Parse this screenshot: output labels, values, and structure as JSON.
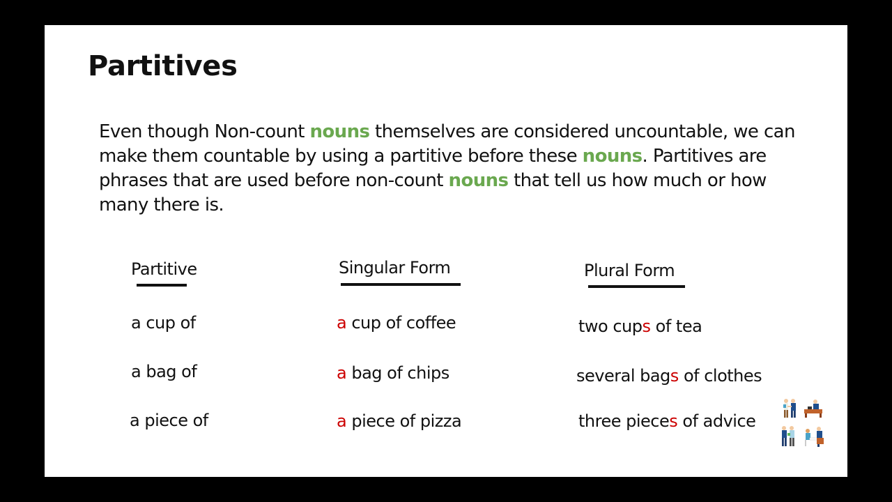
{
  "slide": {
    "title": "Partitives",
    "intro": {
      "segments": [
        {
          "text": "Even though Non-count ",
          "style": "plain"
        },
        {
          "text": "nouns",
          "style": "highlight"
        },
        {
          "text": " themselves are considered uncountable, we can make them countable by using a partitive before these ",
          "style": "plain"
        },
        {
          "text": "nouns",
          "style": "highlight"
        },
        {
          "text": ". Partitives are phrases that are used before non-count ",
          "style": "plain"
        },
        {
          "text": "nouns",
          "style": "highlight"
        },
        {
          "text": " that tell us how much or how many there is.",
          "style": "plain"
        }
      ]
    },
    "table": {
      "headers": [
        "Partitive",
        "Singular Form",
        "Plural Form"
      ],
      "rows": [
        {
          "partitive": "a cup of",
          "singular": {
            "marker": "a",
            "rest": " cup of coffee"
          },
          "plural": {
            "before": "two cup",
            "marker": "s",
            "after": " of tea"
          }
        },
        {
          "partitive": "a bag of",
          "singular": {
            "marker": "a",
            "rest": " bag of chips"
          },
          "plural": {
            "before": "several bag",
            "marker": "s",
            "after": " of clothes"
          }
        },
        {
          "partitive": "a piece of",
          "singular": {
            "marker": "a",
            "rest": " piece of pizza"
          },
          "plural": {
            "before": "three piece",
            "marker": "s",
            "after": " of advice"
          }
        }
      ]
    },
    "illustration": "business-people-meeting-icon",
    "colors": {
      "highlight_green": "#6aa84f",
      "marker_red": "#cc0000",
      "text": "#111111",
      "background": "#ffffff",
      "frame": "#000000"
    }
  }
}
